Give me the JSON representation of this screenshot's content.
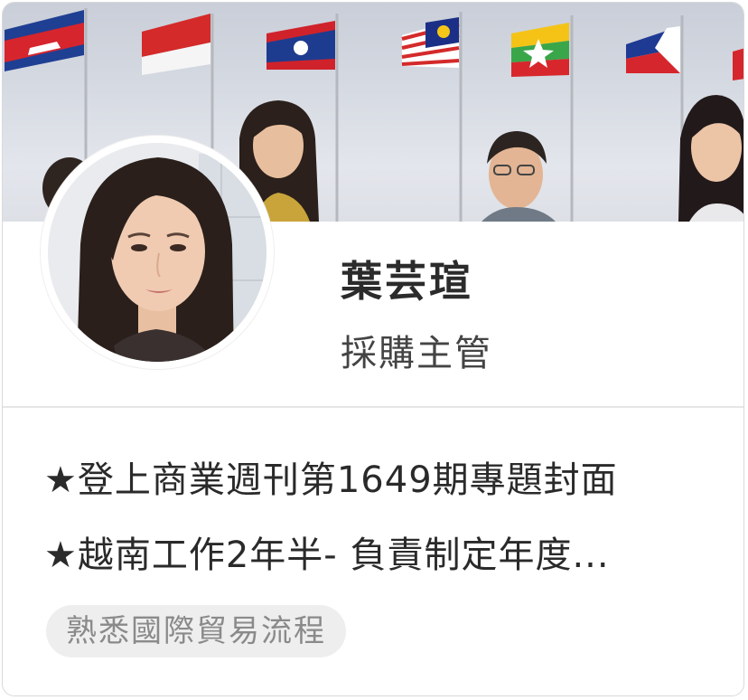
{
  "profile": {
    "name": "葉芸瑄",
    "job_title": "採購主管"
  },
  "highlights": [
    "★登上商業週刊第1649期專題封面",
    "★越南工作2年半- 負責制定年度..."
  ],
  "tags": [
    "熟悉國際貿易流程"
  ]
}
